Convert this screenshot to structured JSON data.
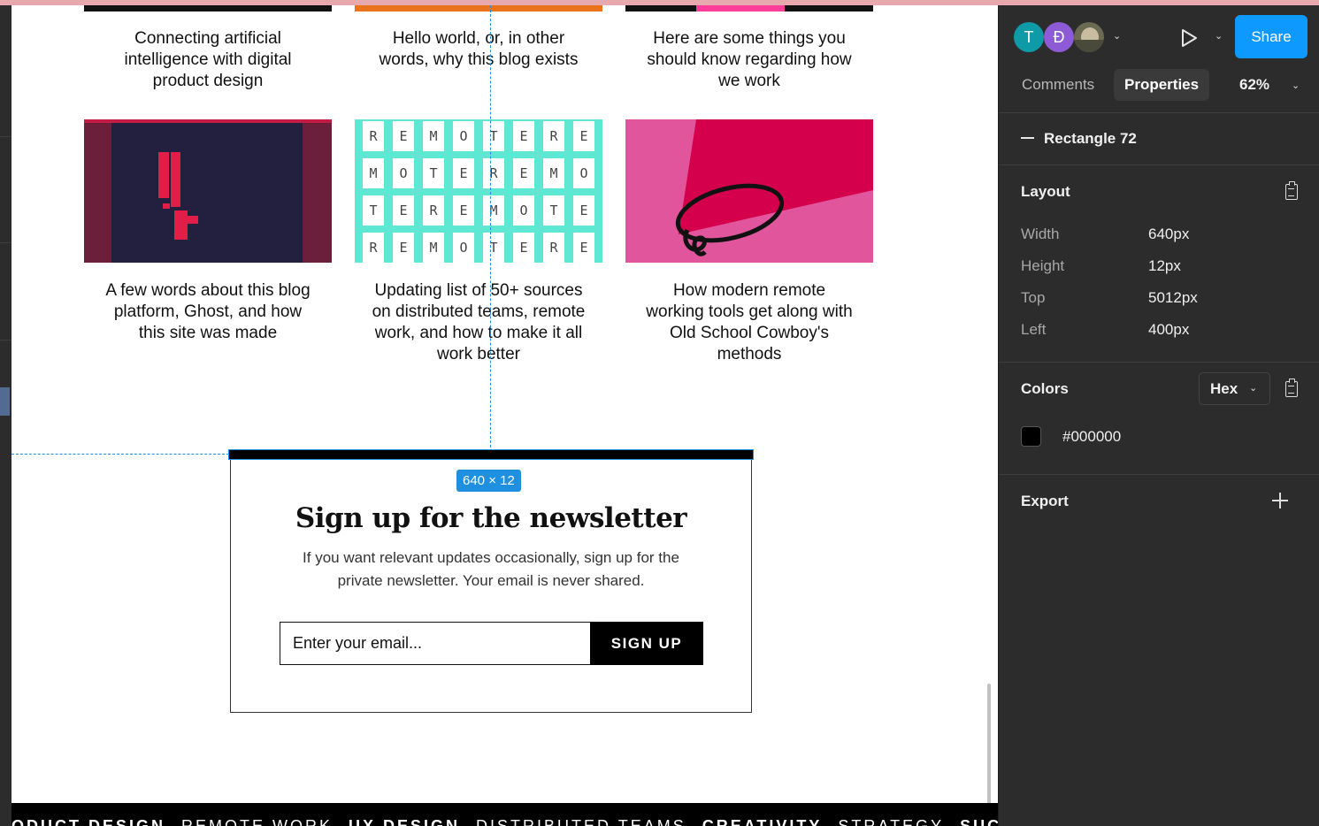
{
  "canvas": {
    "posts_row1": [
      {
        "title_lines": [
          "Connecting artificial",
          "intelligence with digital",
          "product design"
        ]
      },
      {
        "title_lines": [
          "Hello world, or, in other",
          "words, why this blog exists"
        ]
      },
      {
        "title_lines": [
          "Here are some things you",
          "should know regarding how",
          "we work"
        ]
      }
    ],
    "posts_row2": [
      {
        "title_lines": [
          "A few words about this blog",
          "platform, Ghost, and how",
          "this site was made"
        ]
      },
      {
        "title_lines": [
          "Updating list of 50+ sources",
          "on distributed teams, remote",
          "work, and how to make it all",
          "work better"
        ]
      },
      {
        "title_lines": [
          "How modern remote",
          "working tools get along with",
          "Old School Cowboy's",
          "methods"
        ]
      }
    ],
    "remote_tiles": [
      [
        "R",
        "E",
        "M",
        "O",
        "T",
        "E",
        "R",
        "E"
      ],
      [
        "M",
        "O",
        "T",
        "E",
        "R",
        "E",
        "M",
        "O"
      ],
      [
        "T",
        "E",
        "R",
        "E",
        "M",
        "O",
        "T",
        "E"
      ],
      [
        "R",
        "E",
        "M",
        "O",
        "T",
        "E",
        "R",
        "E"
      ]
    ],
    "size_badge": "640 × 12",
    "newsletter": {
      "title": "Sign up for the newsletter",
      "description_line1": "If you want relevant updates occasionally, sign up for the",
      "description_line2": "private newsletter. Your email is never shared.",
      "email_placeholder": "Enter your email...",
      "button_label": "SIGN UP"
    },
    "ticker": [
      {
        "text": "ODUCT DESIGN",
        "bold": true
      },
      {
        "text": "REMOTE WORK",
        "bold": false
      },
      {
        "text": "UX DESIGN",
        "bold": true
      },
      {
        "text": "DISTRIBUTED TEAMS",
        "bold": false
      },
      {
        "text": "CREATIVITY",
        "bold": true
      },
      {
        "text": "STRATEGY",
        "bold": false
      },
      {
        "text": "SUCCESS",
        "bold": true
      }
    ]
  },
  "panel": {
    "avatars": [
      {
        "initial": "T",
        "color": "#0e9aa7"
      },
      {
        "initial": "Đ",
        "color": "#8e5bd6"
      }
    ],
    "share_label": "Share",
    "tabs": {
      "comments": "Comments",
      "properties": "Properties"
    },
    "zoom": "62%",
    "layer_name": "Rectangle 72",
    "layout": {
      "title": "Layout",
      "rows": [
        {
          "label": "Width",
          "value": "640px"
        },
        {
          "label": "Height",
          "value": "12px"
        },
        {
          "label": "Top",
          "value": "5012px"
        },
        {
          "label": "Left",
          "value": "400px"
        }
      ]
    },
    "colors": {
      "title": "Colors",
      "format": "Hex",
      "swatch": "#000000",
      "value": "#000000"
    },
    "export": {
      "title": "Export"
    }
  }
}
